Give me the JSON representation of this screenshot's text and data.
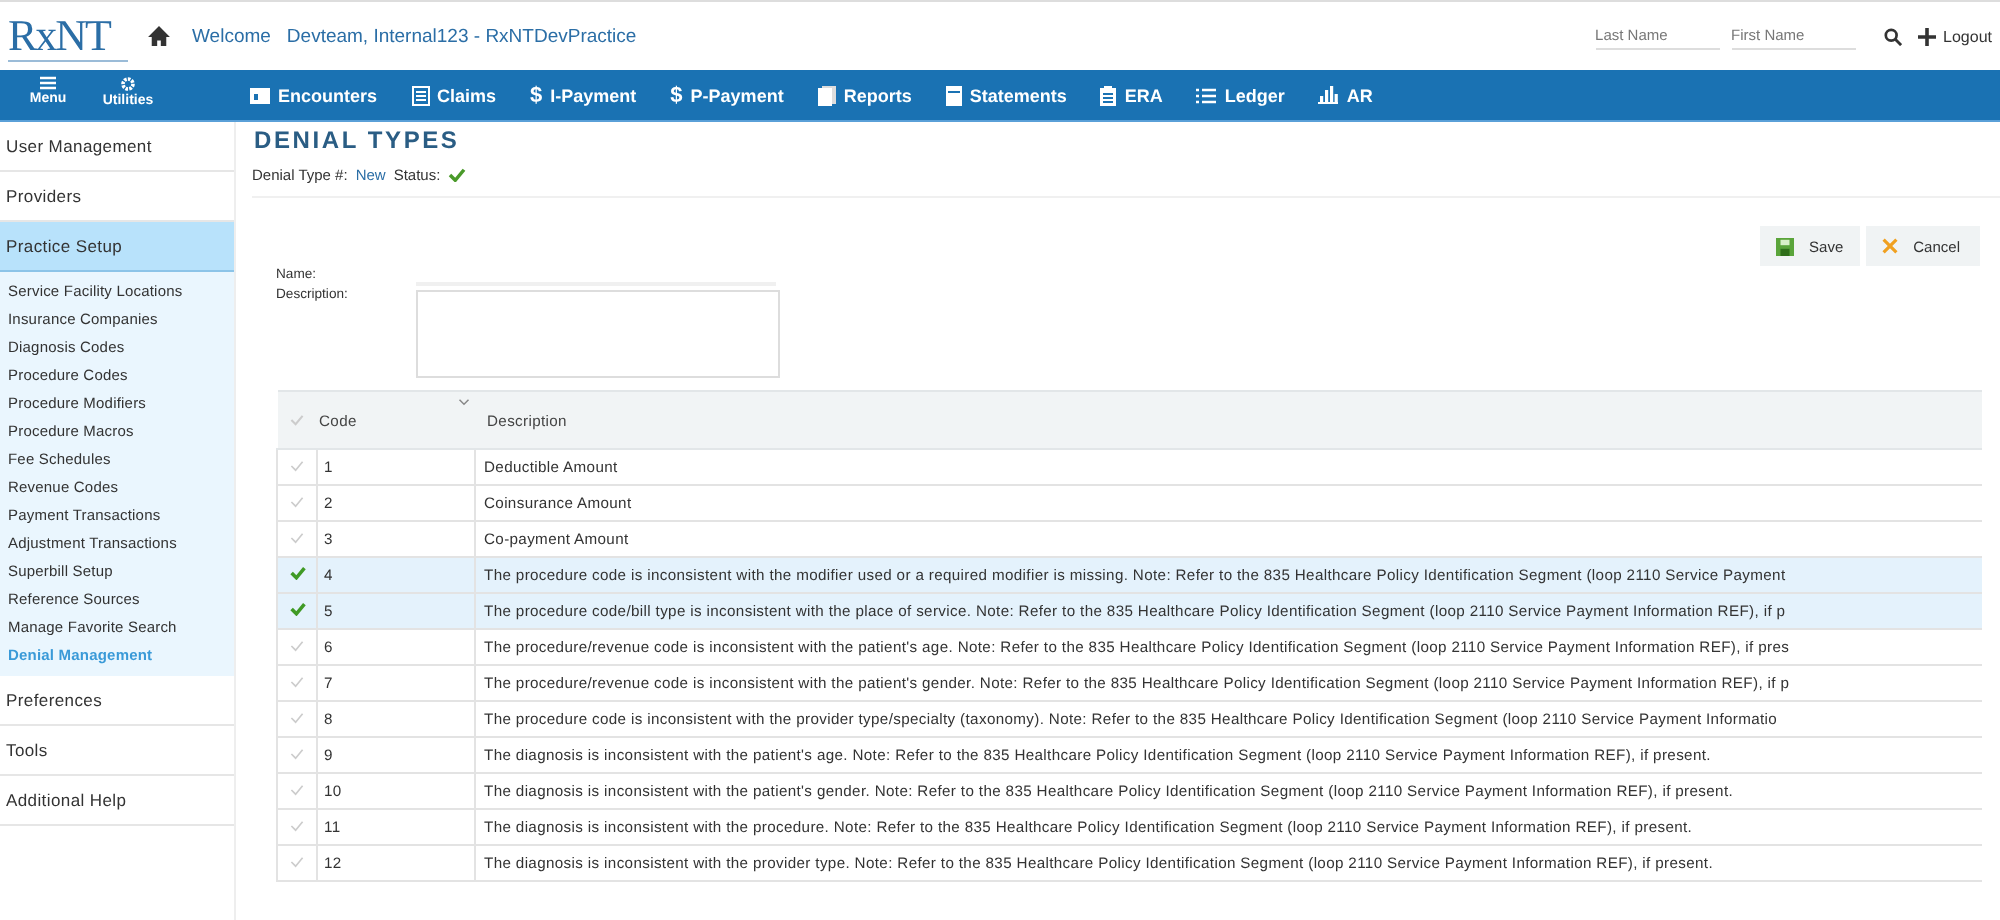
{
  "header": {
    "logo": "RxNT",
    "welcome": "Welcome",
    "user": "Devteam, Internal123 - RxNTDevPractice",
    "search_fields": [
      {
        "placeholder": "Last Name"
      },
      {
        "placeholder": "First Name"
      }
    ],
    "logout": "Logout"
  },
  "utility_buttons": [
    {
      "label": "Menu",
      "kind": "menu"
    },
    {
      "label": "Utilities",
      "kind": "gear"
    }
  ],
  "nav": [
    {
      "label": "Encounters",
      "kind": "calendar"
    },
    {
      "label": "Claims",
      "kind": "list"
    },
    {
      "label": "I-Payment",
      "kind": "dollar",
      "icon": "$"
    },
    {
      "label": "P-Payment",
      "kind": "dollar",
      "icon": "$"
    },
    {
      "label": "Reports",
      "kind": "copy"
    },
    {
      "label": "Statements",
      "kind": "doc"
    },
    {
      "label": "ERA",
      "kind": "clipboard"
    },
    {
      "label": "Ledger",
      "kind": "lines"
    },
    {
      "label": "AR",
      "kind": "chart"
    }
  ],
  "sidebar": {
    "items": [
      {
        "label": "User Management",
        "expanded": false
      },
      {
        "label": "Providers",
        "expanded": false
      },
      {
        "label": "Practice Setup",
        "expanded": true,
        "children": [
          {
            "label": "Service Facility Locations",
            "selected": false
          },
          {
            "label": "Insurance Companies",
            "selected": false
          },
          {
            "label": "Diagnosis Codes",
            "selected": false
          },
          {
            "label": "Procedure Codes",
            "selected": false
          },
          {
            "label": "Procedure Modifiers",
            "selected": false
          },
          {
            "label": "Procedure Macros",
            "selected": false
          },
          {
            "label": "Fee Schedules",
            "selected": false
          },
          {
            "label": "Revenue Codes",
            "selected": false
          },
          {
            "label": "Payment Transactions",
            "selected": false
          },
          {
            "label": "Adjustment Transactions",
            "selected": false
          },
          {
            "label": "Superbill Setup",
            "selected": false
          },
          {
            "label": "Reference Sources",
            "selected": false
          },
          {
            "label": "Manage Favorite Search",
            "selected": false
          },
          {
            "label": "Denial Management",
            "selected": true
          }
        ]
      },
      {
        "label": "Preferences",
        "expanded": false
      },
      {
        "label": "Tools",
        "expanded": false
      },
      {
        "label": "Additional Help",
        "expanded": false
      }
    ]
  },
  "page": {
    "title": "DENIAL TYPES",
    "denial_type_label": "Denial Type #:",
    "denial_type_value": "New",
    "status_label": "Status:",
    "status_active": true
  },
  "buttons": [
    {
      "label": "Save",
      "kind": "save"
    },
    {
      "label": "Cancel",
      "kind": "cancel"
    }
  ],
  "form": {
    "name_label": "Name:",
    "description_label": "Description:"
  },
  "table": {
    "columns": [
      "Code",
      "Description"
    ],
    "all_checked": false,
    "rows": [
      {
        "code": "1",
        "description": "Deductible Amount",
        "checked": false
      },
      {
        "code": "2",
        "description": "Coinsurance Amount",
        "checked": false
      },
      {
        "code": "3",
        "description": "Co-payment Amount",
        "checked": false
      },
      {
        "code": "4",
        "description": "The procedure code is inconsistent with the modifier used or a required modifier is missing. Note: Refer to the 835 Healthcare Policy Identification Segment (loop 2110 Service Payment",
        "checked": true
      },
      {
        "code": "5",
        "description": "The procedure code/bill type is inconsistent with the place of service. Note: Refer to the 835 Healthcare Policy Identification Segment (loop 2110 Service Payment Information REF), if p",
        "checked": true
      },
      {
        "code": "6",
        "description": "The procedure/revenue code is inconsistent with the patient's age. Note: Refer to the 835 Healthcare Policy Identification Segment (loop 2110 Service Payment Information REF), if pres",
        "checked": false
      },
      {
        "code": "7",
        "description": "The procedure/revenue code is inconsistent with the patient's gender. Note: Refer to the 835 Healthcare Policy Identification Segment (loop 2110 Service Payment Information REF), if p",
        "checked": false
      },
      {
        "code": "8",
        "description": "The procedure code is inconsistent with the provider type/specialty (taxonomy). Note: Refer to the 835 Healthcare Policy Identification Segment (loop 2110 Service Payment Informatio",
        "checked": false
      },
      {
        "code": "9",
        "description": "The diagnosis is inconsistent with the patient's age. Note: Refer to the 835 Healthcare Policy Identification Segment (loop 2110 Service Payment Information REF), if present.",
        "checked": false
      },
      {
        "code": "10",
        "description": "The diagnosis is inconsistent with the patient's gender. Note: Refer to the 835 Healthcare Policy Identification Segment (loop 2110 Service Payment Information REF), if present.",
        "checked": false
      },
      {
        "code": "11",
        "description": "The diagnosis is inconsistent with the procedure. Note: Refer to the 835 Healthcare Policy Identification Segment (loop 2110 Service Payment Information REF), if present.",
        "checked": false
      },
      {
        "code": "12",
        "description": "The diagnosis is inconsistent with the provider type. Note: Refer to the 835 Healthcare Policy Identification Segment (loop 2110 Service Payment Information REF), if present.",
        "checked": false
      }
    ]
  }
}
